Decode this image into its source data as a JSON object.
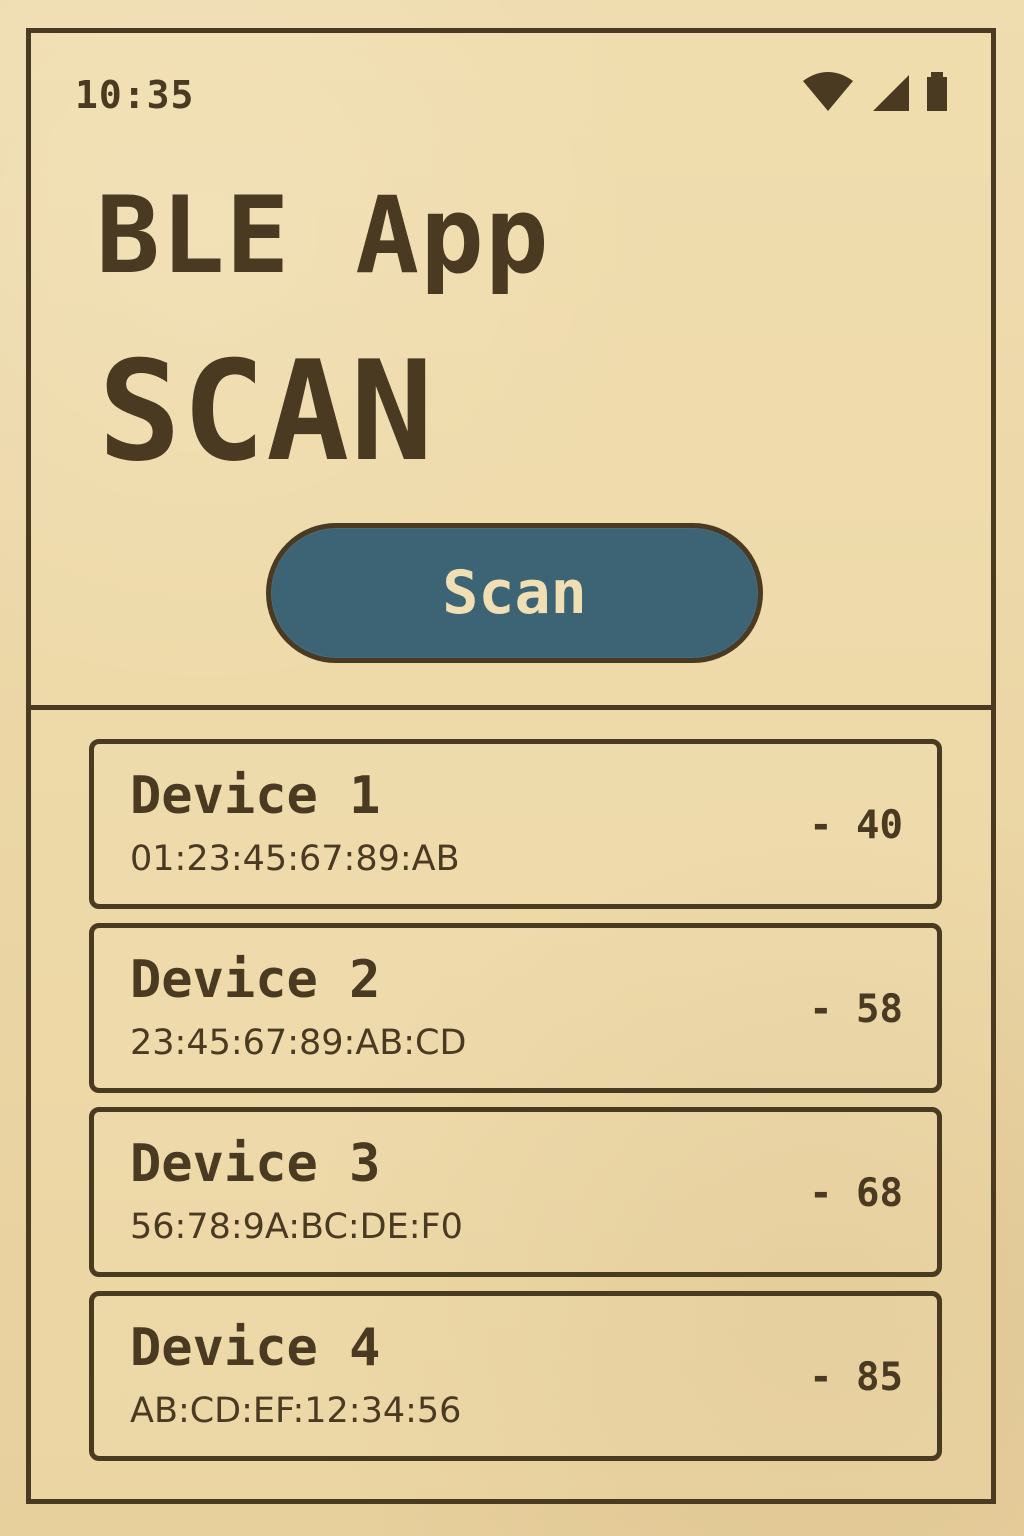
{
  "status_bar": {
    "time": "10:35",
    "icons": [
      "wifi-icon",
      "cellular-signal-icon",
      "battery-icon"
    ]
  },
  "header": {
    "app_title": "BLE App",
    "screen_title": "SCAN"
  },
  "actions": {
    "scan_label": "Scan"
  },
  "devices": [
    {
      "name": "Device 1",
      "address": "01:23:45:67:89:AB",
      "rssi": "- 40"
    },
    {
      "name": "Device 2",
      "address": "23:45:67:89:AB:CD",
      "rssi": "- 58"
    },
    {
      "name": "Device 3",
      "address": "56:78:9A:BC:DE:F0",
      "rssi": "- 68"
    },
    {
      "name": "Device 4",
      "address": "AB:CD:EF:12:34:56",
      "rssi": "- 85"
    }
  ],
  "colors": {
    "background": "#ead6a4",
    "ink": "#4a3a22",
    "button": "#3d6474",
    "button_text": "#f0dfb4"
  }
}
